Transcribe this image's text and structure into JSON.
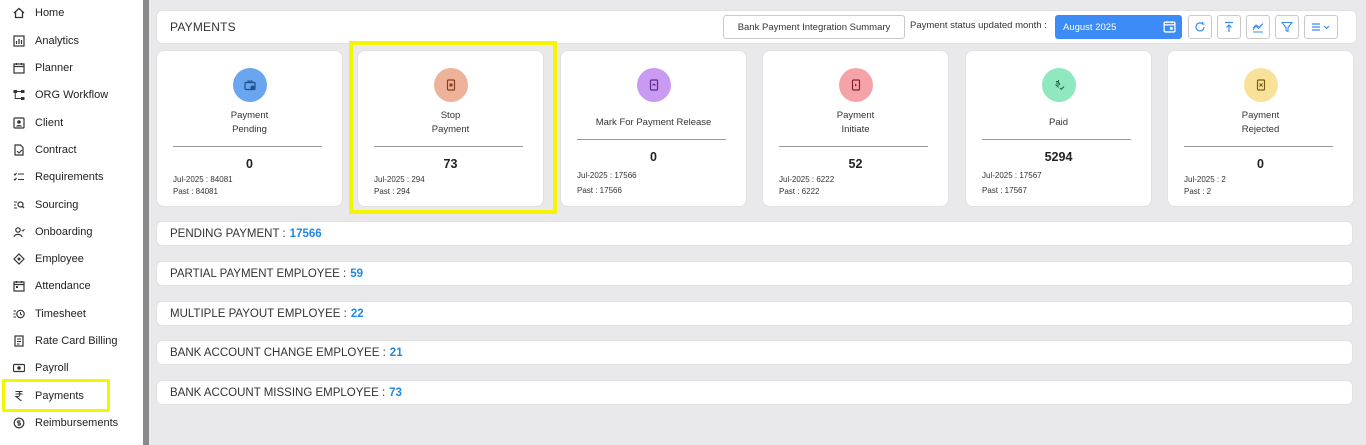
{
  "sidebar": {
    "items": [
      {
        "label": "Home",
        "icon": "home-icon"
      },
      {
        "label": "Analytics",
        "icon": "analytics-icon"
      },
      {
        "label": "Planner",
        "icon": "calendar-icon"
      },
      {
        "label": "ORG Workflow",
        "icon": "workflow-icon"
      },
      {
        "label": "Client",
        "icon": "client-icon"
      },
      {
        "label": "Contract",
        "icon": "contract-icon"
      },
      {
        "label": "Requirements",
        "icon": "checklist-icon"
      },
      {
        "label": "Sourcing",
        "icon": "sourcing-icon"
      },
      {
        "label": "Onboarding",
        "icon": "onboarding-icon"
      },
      {
        "label": "Employee",
        "icon": "employee-icon"
      },
      {
        "label": "Attendance",
        "icon": "attendance-icon"
      },
      {
        "label": "Timesheet",
        "icon": "timesheet-icon"
      },
      {
        "label": "Rate Card Billing",
        "icon": "billing-icon"
      },
      {
        "label": "Payroll",
        "icon": "payroll-icon"
      },
      {
        "label": "Payments",
        "icon": "rupee-icon"
      },
      {
        "label": "Reimbursements",
        "icon": "reimburse-icon"
      }
    ]
  },
  "header": {
    "title": "PAYMENTS",
    "bank_button": "Bank Payment Integration Summary",
    "status_label": "Payment status updated month :",
    "month": "August 2025"
  },
  "cards": [
    {
      "title1": "Payment",
      "title2": "Pending",
      "count": "0",
      "meta1": "Jul-2025 : 84081",
      "meta2": "Past : 84081",
      "color": "#6aa6f0",
      "icon_color": "#1d4f91"
    },
    {
      "title1": "Stop",
      "title2": "Payment",
      "count": "73",
      "meta1": "Jul-2025 : 294",
      "meta2": "Past : 294",
      "color": "#eeb29b",
      "icon_color": "#8a3a1f"
    },
    {
      "title1": "Mark For Payment Release",
      "title2": "",
      "count": "0",
      "meta1": "Jul-2025 : 17566",
      "meta2": "Past : 17566",
      "color": "#c89af2",
      "icon_color": "#5b2a8a"
    },
    {
      "title1": "Payment",
      "title2": "Initiate",
      "count": "52",
      "meta1": "Jul-2025 : 6222",
      "meta2": "Past : 6222",
      "color": "#f5a3a8",
      "icon_color": "#8a1f2a"
    },
    {
      "title1": "Paid",
      "title2": "",
      "count": "5294",
      "meta1": "Jul-2025 : 17567",
      "meta2": "Past : 17567",
      "color": "#8fe8bf",
      "icon_color": "#1f6b46"
    },
    {
      "title1": "Payment",
      "title2": "Rejected",
      "count": "0",
      "meta1": "Jul-2025 : 2",
      "meta2": "Past : 2",
      "color": "#f8e29a",
      "icon_color": "#7a5e10"
    }
  ],
  "summary": [
    {
      "label": "PENDING PAYMENT :",
      "value": "17566"
    },
    {
      "label": "PARTIAL PAYMENT EMPLOYEE :",
      "value": "59"
    },
    {
      "label": "MULTIPLE PAYOUT EMPLOYEE :",
      "value": "22"
    },
    {
      "label": "BANK ACCOUNT CHANGE EMPLOYEE :",
      "value": "21"
    },
    {
      "label": "BANK ACCOUNT MISSING EMPLOYEE :",
      "value": "73"
    }
  ]
}
